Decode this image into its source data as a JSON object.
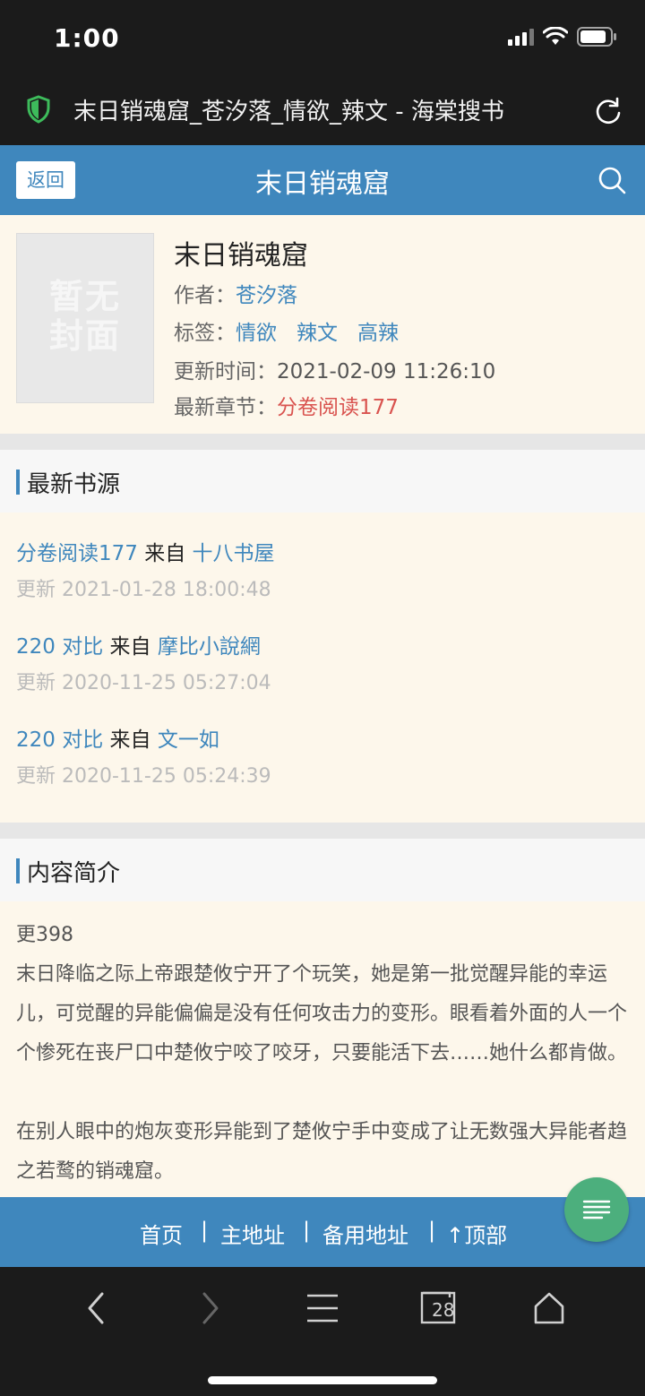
{
  "status_bar": {
    "time": "1:00"
  },
  "browser": {
    "title": "末日销魂窟_苍汐落_情欲_辣文 - 海棠搜书",
    "tab_count": "28"
  },
  "header": {
    "back_label": "返回",
    "title": "末日销魂窟"
  },
  "book": {
    "cover_text_line1": "暂无",
    "cover_text_line2": "封面",
    "name": "末日销魂窟",
    "author_label": "作者：",
    "author": "苍汐落",
    "tags_label": "标签：",
    "tags": [
      "情欲",
      "辣文",
      "高辣"
    ],
    "update_label": "更新时间：",
    "update_time": "2021-02-09 11:26:10",
    "latest_label": "最新章节：",
    "latest_chapter": "分卷阅读177"
  },
  "sources_section": {
    "title": "最新书源",
    "items": [
      {
        "chapter": "分卷阅读177",
        "from": "来自",
        "site": "十八书屋",
        "updated": "更新 2021-01-28 18:00:48"
      },
      {
        "chapter": "220 对比",
        "from": "来自",
        "site": "摩比小說網",
        "updated": "更新 2020-11-25 05:27:04"
      },
      {
        "chapter": "220 对比",
        "from": "来自",
        "site": "文一如",
        "updated": "更新 2020-11-25 05:24:39"
      }
    ]
  },
  "intro_section": {
    "title": "内容简介",
    "lines": [
      "更398",
      "末日降临之际上帝跟楚攸宁开了个玩笑，她是第一批觉醒异能的幸运儿，可觉醒的异能偏偏是没有任何攻击力的变形。眼看着外面的人一个个惨死在丧尸口中楚攸宁咬了咬牙，只要能活下去……她什么都肯做。",
      "在别人眼中的炮灰变形异能到了楚攸宁手中变成了让无数强大异能者趋之若鹜的销魂窟。"
    ]
  },
  "footer": {
    "home": "首页",
    "main_address": "主地址",
    "backup_address": "备用地址",
    "top": "↑顶部",
    "separator": "|"
  },
  "colors": {
    "brand": "#3f87bd",
    "paper": "#fdf7eb",
    "fab": "#4caf7d",
    "chapter_red": "#d9534f"
  }
}
